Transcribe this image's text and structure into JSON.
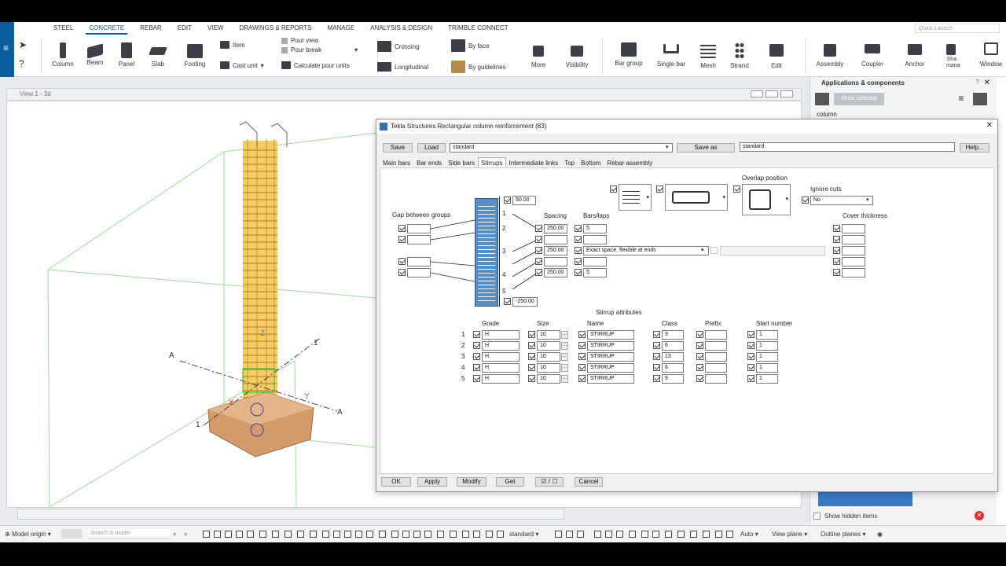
{
  "ribbon_tabs": [
    "STEEL",
    "CONCRETE",
    "REBAR",
    "EDIT",
    "VIEW",
    "DRAWINGS & REPORTS",
    "MANAGE",
    "ANALYSIS & DESIGN",
    "TRIMBLE CONNECT"
  ],
  "quick_launch": "Quick Launch",
  "ribbon": {
    "column": "Column",
    "beam": "Beam",
    "panel": "Panel",
    "slab": "Slab",
    "footing": "Footing",
    "item": "Item",
    "cast_unit": "Cast unit",
    "pour_view": "Pour view",
    "pour_break": "Pour break",
    "calc_pour": "Calculate pour units",
    "crossing": "Crossing",
    "longitudinal": "Longitudinal",
    "by_face": "By face",
    "by_guidelines": "By guidelines",
    "more": "More",
    "visibility": "Visibility",
    "bar_group": "Bar group",
    "single_bar": "Single bar",
    "mesh": "Mesh",
    "strand": "Strand",
    "edit": "Edit",
    "assembly": "Assembly",
    "coupler": "Coupler",
    "anchor": "Anchor",
    "sha_manage": "Sha mana",
    "window": "Window"
  },
  "view": {
    "title": "View 1 - 3d",
    "labels": {
      "A1": "A",
      "A2": "A",
      "one1": "1",
      "one2": "1",
      "z": "Z",
      "y": "Y",
      "x": "X"
    }
  },
  "right_panel": {
    "title": "Applications & components",
    "show_selected": "Show selected",
    "search": "column",
    "show_hidden": "Show hidden items"
  },
  "dialog": {
    "title": "Tekla Structures  Rectangular column reinforcement (83)",
    "save": "Save",
    "load": "Load",
    "load_value": "standard",
    "save_as": "Save as",
    "save_as_value": "standard",
    "help": "Help...",
    "tabs": [
      "Main bars",
      "Bar ends",
      "Side bars",
      "Stirrups",
      "Intermediate links",
      "Top",
      "Bottom",
      "Rebar assembly"
    ],
    "active_tab": "Stirrups",
    "gap_between_groups": "Gap between groups",
    "spacing_label": "Spacing",
    "bars_laps_label": "Bars/laps",
    "top_offset": "50.00",
    "bottom_offset": "-250.00",
    "group_numbers": [
      "1",
      "2",
      "3",
      "4",
      "5"
    ],
    "spacing": [
      "250.00",
      "",
      "250.00",
      "",
      "250.00"
    ],
    "bars": [
      "5",
      "",
      "",
      "",
      "5"
    ],
    "spacing_mode": "Exact space, flexible at ends",
    "overlap_position": "Overlap position",
    "ignore_cuts": "Ignore cuts",
    "ignore_cuts_value": "No",
    "cover_thickness": "Cover thickness",
    "stirrup_attributes": "Stirrup attributes",
    "attr_headers": {
      "grade": "Grade",
      "size": "Size",
      "name": "Name",
      "class": "Class",
      "prefix": "Prefix",
      "start": "Start number"
    },
    "stirrup_rows": [
      {
        "n": "1",
        "grade": "H",
        "size": "10",
        "name": "STIRRUP",
        "cls": "9",
        "prefix": "",
        "start": "1"
      },
      {
        "n": "2",
        "grade": "H",
        "size": "10",
        "name": "STIRRUP",
        "cls": "6",
        "prefix": "",
        "start": "1"
      },
      {
        "n": "3",
        "grade": "H",
        "size": "10",
        "name": "STIRRUP",
        "cls": "13",
        "prefix": "",
        "start": "1"
      },
      {
        "n": "4",
        "grade": "H",
        "size": "10",
        "name": "STIRRUP",
        "cls": "6",
        "prefix": "",
        "start": "1"
      },
      {
        "n": "5",
        "grade": "H",
        "size": "10",
        "name": "STIRRUP",
        "cls": "9",
        "prefix": "",
        "start": "1"
      }
    ],
    "ok": "OK",
    "apply": "Apply",
    "modify": "Modify",
    "get": "Get",
    "toggle": "☑ / ☐",
    "cancel": "Cancel"
  },
  "status": {
    "model_origin": "Model origin",
    "search_placeholder": "Search in model",
    "standard": "standard",
    "auto": "Auto",
    "view_plane": "View plane",
    "outline_planes": "Outline planes"
  },
  "colors": {
    "accent": "#0d5a9c",
    "rebar": "#e8b83a",
    "footing": "#c98a5a",
    "grid": "#9fd89a"
  }
}
